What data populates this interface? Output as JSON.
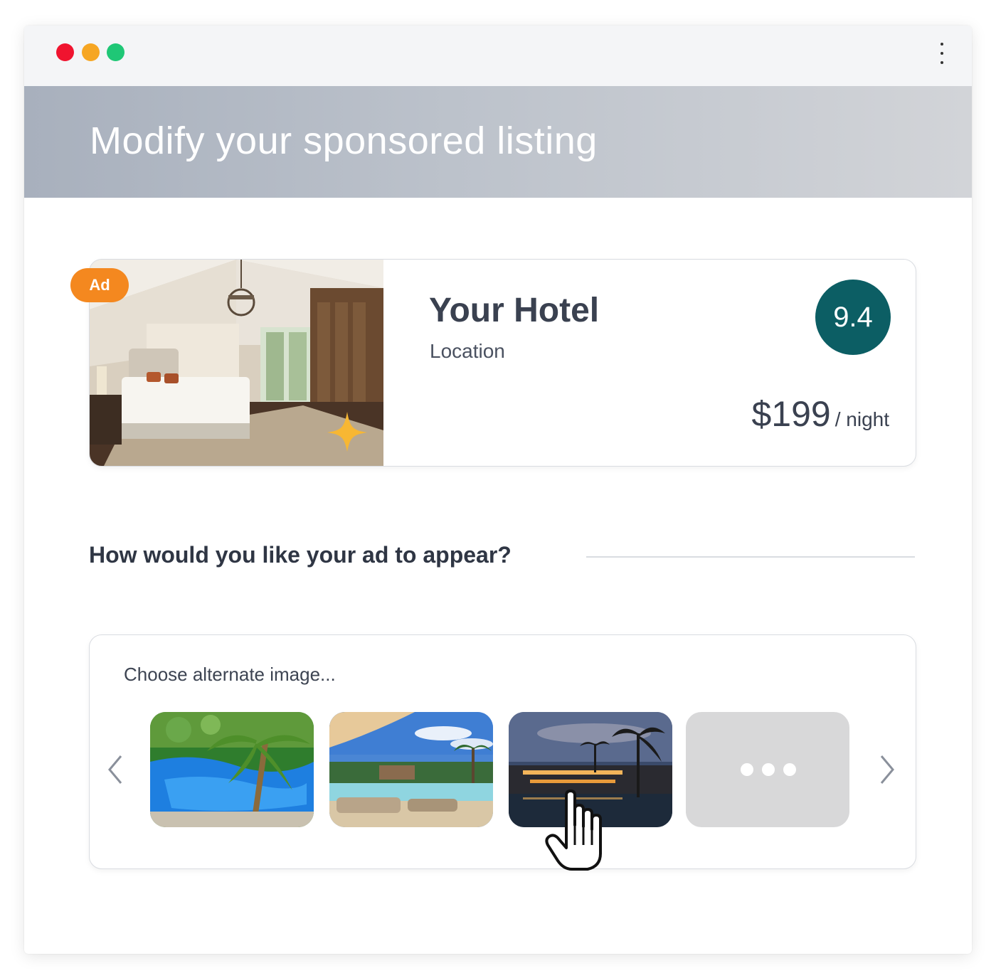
{
  "window": {
    "controls": [
      "close",
      "minimize",
      "maximize"
    ],
    "menu_icon": "kebab-menu-icon"
  },
  "banner": {
    "title": "Modify your sponsored listing"
  },
  "listing": {
    "badge": "Ad",
    "name": "Your Hotel",
    "location": "Location",
    "rating": "9.4",
    "price": "$199",
    "price_unit": "/ night",
    "photo_icon": "sparkle-icon"
  },
  "appearance": {
    "question": "How would you like your ad to appear?",
    "chooser_label": "Choose alternate image...",
    "thumbnails": [
      "resort-pool-palms",
      "beach-pool-umbrella",
      "resort-night-palms",
      "more-options"
    ]
  },
  "colors": {
    "accent_rating": "#0c5e64",
    "ad_badge": "#f4881f",
    "dot_red": "#f0142f",
    "dot_yellow": "#f6a623",
    "dot_green": "#1fc776"
  }
}
